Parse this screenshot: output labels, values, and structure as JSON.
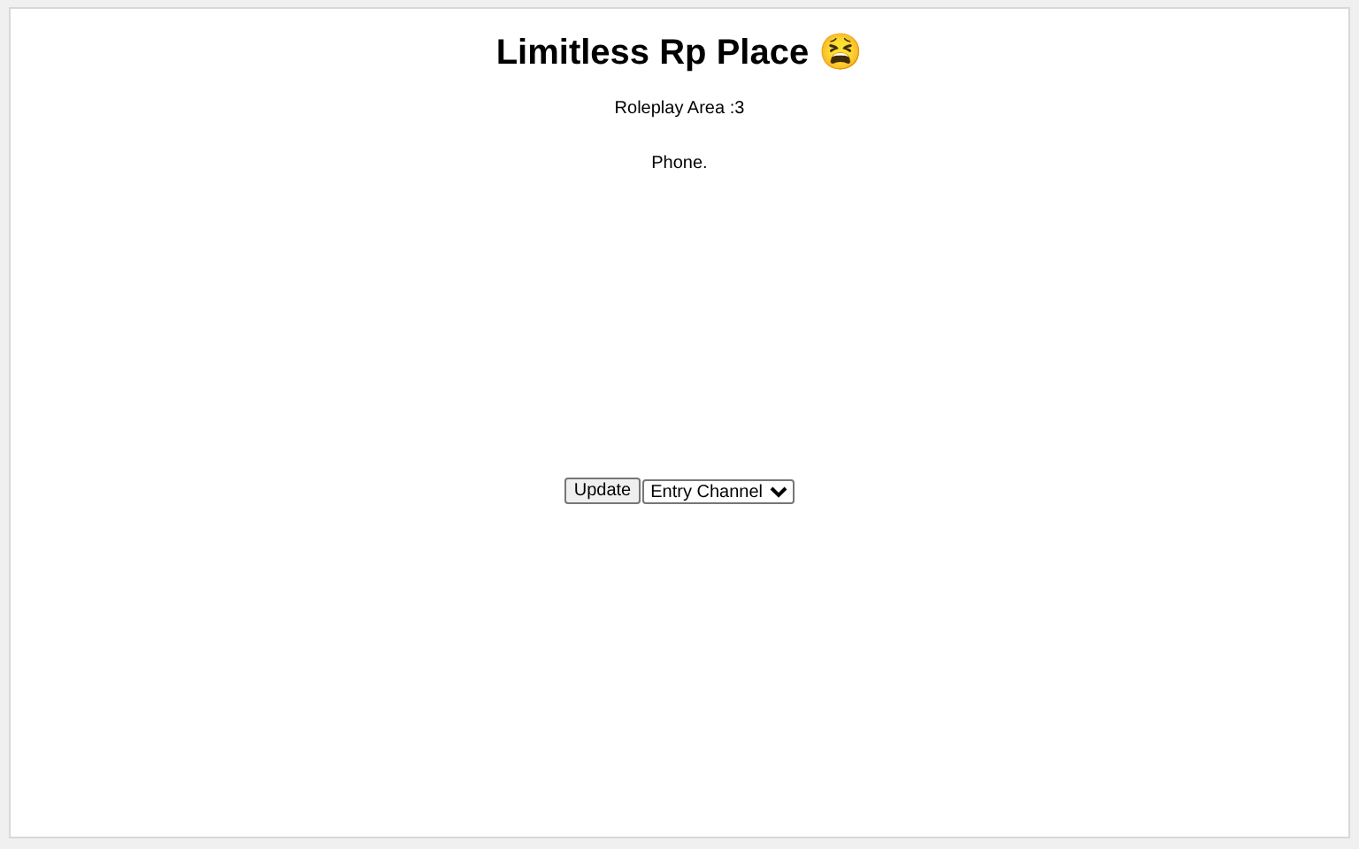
{
  "title": "Limitless Rp Place 😫",
  "subtitle": "Roleplay Area :3",
  "note": "Phone.",
  "controls": {
    "button": "Update",
    "dropdown": "Entry Channel"
  }
}
